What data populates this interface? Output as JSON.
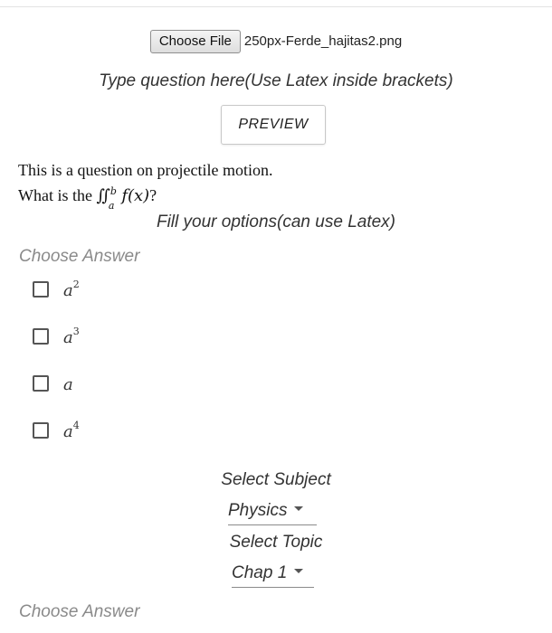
{
  "upload": {
    "button_label": "Choose File",
    "file_name": "250px-Ferde_hajitas2.png"
  },
  "question": {
    "label": "Type question here(Use Latex inside brackets)",
    "preview_button": "PREVIEW",
    "line1": "This is a question on projectile motion.",
    "line2_prefix": "What is the ",
    "integral_sign": "∬",
    "upper_limit": "b",
    "lower_limit": "a",
    "integrand": "f(x)",
    "line2_suffix": "?"
  },
  "options": {
    "label": "Fill your options(can use Latex)",
    "choose_answer_label": "Choose Answer",
    "items": [
      {
        "base": "a",
        "exponent": "2"
      },
      {
        "base": "a",
        "exponent": "3"
      },
      {
        "base": "a",
        "exponent": ""
      },
      {
        "base": "a",
        "exponent": "4"
      }
    ]
  },
  "subject": {
    "label": "Select Subject",
    "selected": "Physics"
  },
  "topic": {
    "label": "Select Topic",
    "selected": "Chap 1"
  },
  "footer": {
    "choose_answer_label": "Choose Answer"
  },
  "icons": {
    "dropdown": "triangle-down-icon",
    "checkbox": "checkbox-unchecked-icon"
  }
}
